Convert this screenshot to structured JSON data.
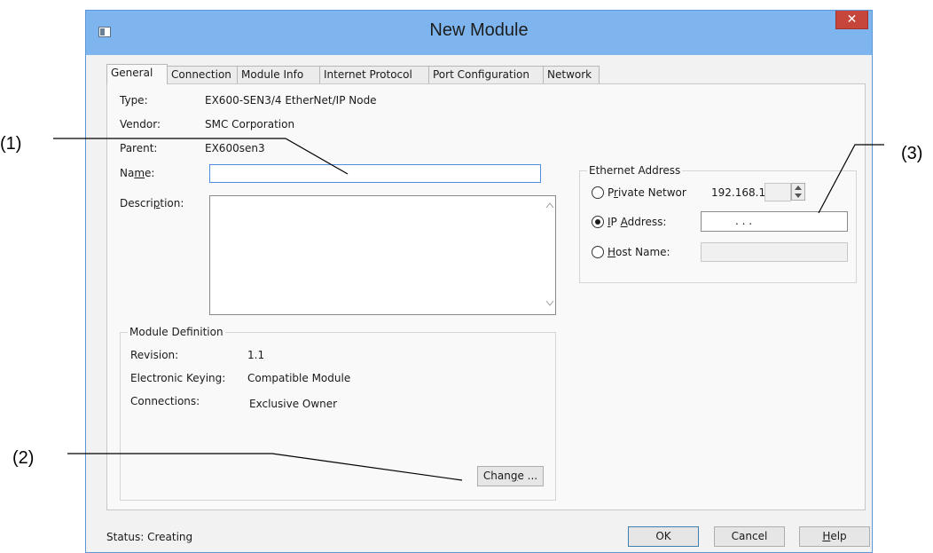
{
  "window": {
    "title": "New Module",
    "close_glyph": "✕"
  },
  "tabs": [
    {
      "label": "General",
      "active": true
    },
    {
      "label": "Connection",
      "active": false
    },
    {
      "label": "Module Info",
      "active": false
    },
    {
      "label": "Internet Protocol",
      "active": false
    },
    {
      "label": "Port Configuration",
      "active": false
    },
    {
      "label": "Network",
      "active": false
    }
  ],
  "general": {
    "type_label": "Type:",
    "type_value": "EX600-SEN3/4 EtherNet/IP Node",
    "vendor_label": "Vendor:",
    "vendor_value": "SMC Corporation",
    "parent_label": "Parent:",
    "parent_value": "EX600sen3",
    "name_label_pre": "Na",
    "name_label_accel": "m",
    "name_label_post": "e:",
    "name_value": "",
    "description_label_pre": "Descri",
    "description_label_accel": "p",
    "description_label_post": "tion:",
    "description_value": ""
  },
  "module_definition": {
    "title": "Module Definition",
    "revision_label": "Revision:",
    "revision_value": "1.1",
    "keying_label": "Electronic Keying:",
    "keying_value": "Compatible Module",
    "connections_label": "Connections:",
    "connections_value": "Exclusive Owner",
    "change_pre": "Chan",
    "change_accel": "g",
    "change_post": "e ..."
  },
  "ethernet": {
    "title": "Ethernet Address",
    "private_pre": "P",
    "private_accel": "r",
    "private_post": "ivate Networ",
    "private_prefix": "192.168.1.",
    "private_checked": false,
    "ip_pre": "",
    "ip_accel": "I",
    "ip_mid": "P ",
    "ip_accel2": "A",
    "ip_post": "ddress:",
    "ip_value": ".          .          .",
    "ip_checked": true,
    "host_accel": "H",
    "host_post": "ost Name:",
    "host_value": "",
    "host_checked": false
  },
  "footer": {
    "status": "Status:  Creating",
    "ok": "OK",
    "cancel": "Cancel",
    "help_accel": "H",
    "help_post": "elp"
  },
  "callouts": {
    "one": "(1)",
    "two": "(2)",
    "three": "(3)"
  }
}
